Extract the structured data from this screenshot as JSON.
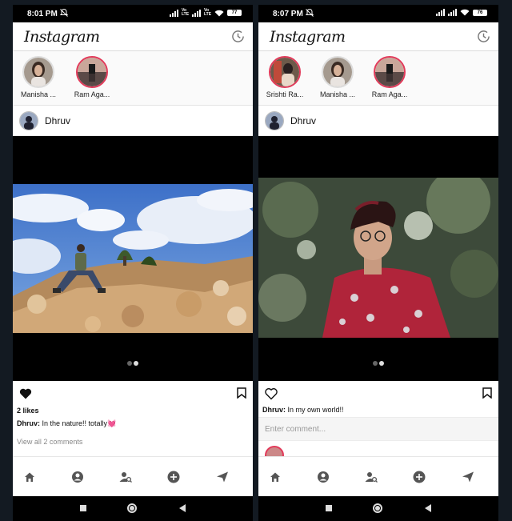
{
  "left": {
    "status": {
      "time": "8:01 PM",
      "battery": "77"
    },
    "app": {
      "logo": "Instagram"
    },
    "stories": [
      {
        "name": "Manisha ..."
      },
      {
        "name": "Ram Aga..."
      }
    ],
    "post": {
      "username": "Dhruv",
      "likes": "2 likes",
      "caption_user": "Dhruv:",
      "caption_text": " In the nature!! totally💓",
      "comments_link": "View all 2 comments"
    }
  },
  "right": {
    "status": {
      "time": "8:07 PM",
      "battery": "76"
    },
    "app": {
      "logo": "Instagram"
    },
    "stories": [
      {
        "name": "Srishti Ra..."
      },
      {
        "name": "Manisha ..."
      },
      {
        "name": "Ram Aga..."
      }
    ],
    "post": {
      "username": "Dhruv",
      "caption_user": "Dhruv:",
      "caption_text": " In my own world!!",
      "comment_placeholder": "Enter comment..."
    }
  },
  "colors": {
    "accent": "#e23a5a",
    "screen_bg": "#131a22"
  }
}
